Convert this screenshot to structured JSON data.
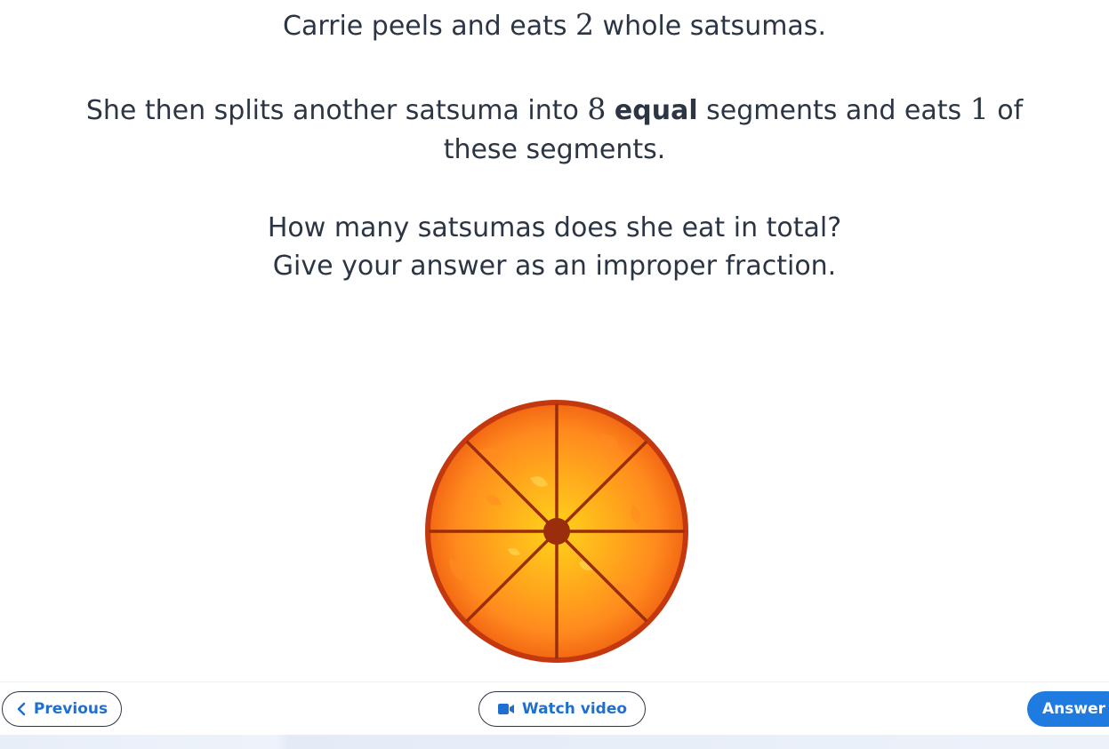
{
  "question": {
    "line1_pre": "Carrie peels and eats ",
    "line1_num": "2",
    "line1_post": " whole satsumas.",
    "line2_pre": "She then splits another satsuma into ",
    "line2_num": "8",
    "line2_bold": "equal",
    "line2_mid": " segments and eats ",
    "line2_num2": "1",
    "line2_post": " of",
    "line3": "these segments.",
    "line4": "How many satsumas does she eat in total?",
    "line5": "Give your answer as an improper fraction."
  },
  "illustration": {
    "name": "satsuma-cross-section",
    "segments": 8
  },
  "footer": {
    "previous_label": "Previous",
    "watch_video_label": "Watch video",
    "answer_label": "Answer"
  },
  "colors": {
    "accent": "#1f7be0",
    "text": "#2c3544",
    "orange_rind": "#c4380f",
    "orange_flesh": "#ff9a1f"
  }
}
